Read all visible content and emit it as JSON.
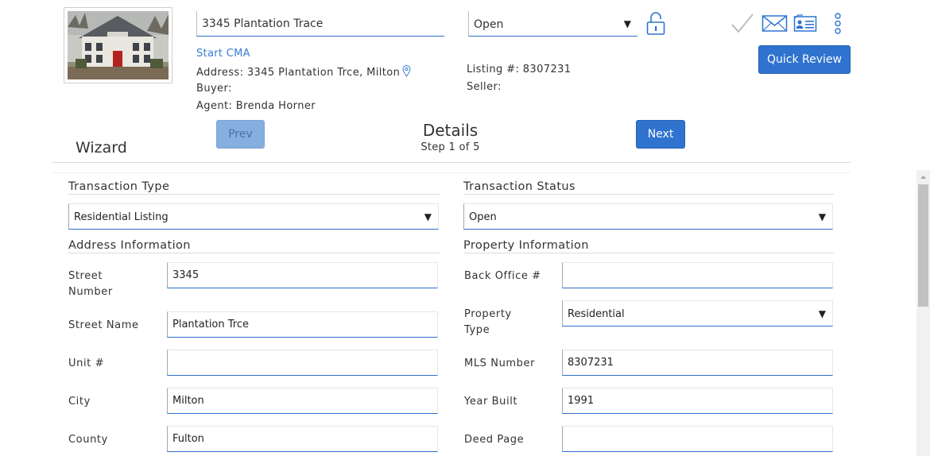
{
  "header": {
    "listing_title": "3345 Plantation Trace",
    "status": "Open",
    "start_cma": "Start CMA",
    "address": "Address: 3345 Plantation Trce, Milton",
    "buyer": "Buyer:",
    "agent": "Agent: Brenda Horner",
    "listing_number": "Listing #: 8307231",
    "seller": "Seller:",
    "quick_review": "Quick Review"
  },
  "wizard": {
    "label": "Wizard",
    "prev": "Prev",
    "next": "Next",
    "step_title": "Details",
    "step_sub": "Step 1 of 5"
  },
  "form": {
    "transaction_type": {
      "label": "Transaction Type",
      "value": "Residential Listing"
    },
    "transaction_status": {
      "label": "Transaction Status",
      "value": "Open"
    },
    "address_info": {
      "heading": "Address Information",
      "street_number": {
        "label": "Street Number",
        "value": "3345"
      },
      "street_name": {
        "label": "Street Name",
        "value": "Plantation Trce"
      },
      "unit": {
        "label": "Unit #",
        "value": ""
      },
      "city": {
        "label": "City",
        "value": "Milton"
      },
      "county": {
        "label": "County",
        "value": "Fulton"
      }
    },
    "property_info": {
      "heading": "Property Information",
      "back_office": {
        "label": "Back Office #",
        "value": ""
      },
      "property_type": {
        "label": "Property Type",
        "value": "Residential"
      },
      "mls_number": {
        "label": "MLS Number",
        "value": "8307231"
      },
      "year_built": {
        "label": "Year Built",
        "value": "1991"
      },
      "deed_page": {
        "label": "Deed Page",
        "value": ""
      }
    }
  },
  "icons": {
    "lock": "unlock-icon",
    "check": "checkmark-icon",
    "mail": "envelope-icon",
    "contact": "contact-card-icon",
    "more": "more-vertical-icon",
    "pin": "map-pin-icon",
    "caret": "triangle-down-icon"
  },
  "colors": {
    "accent": "#2f73cf",
    "link": "#3a7bd5",
    "prev_disabled": "#86aedf"
  }
}
